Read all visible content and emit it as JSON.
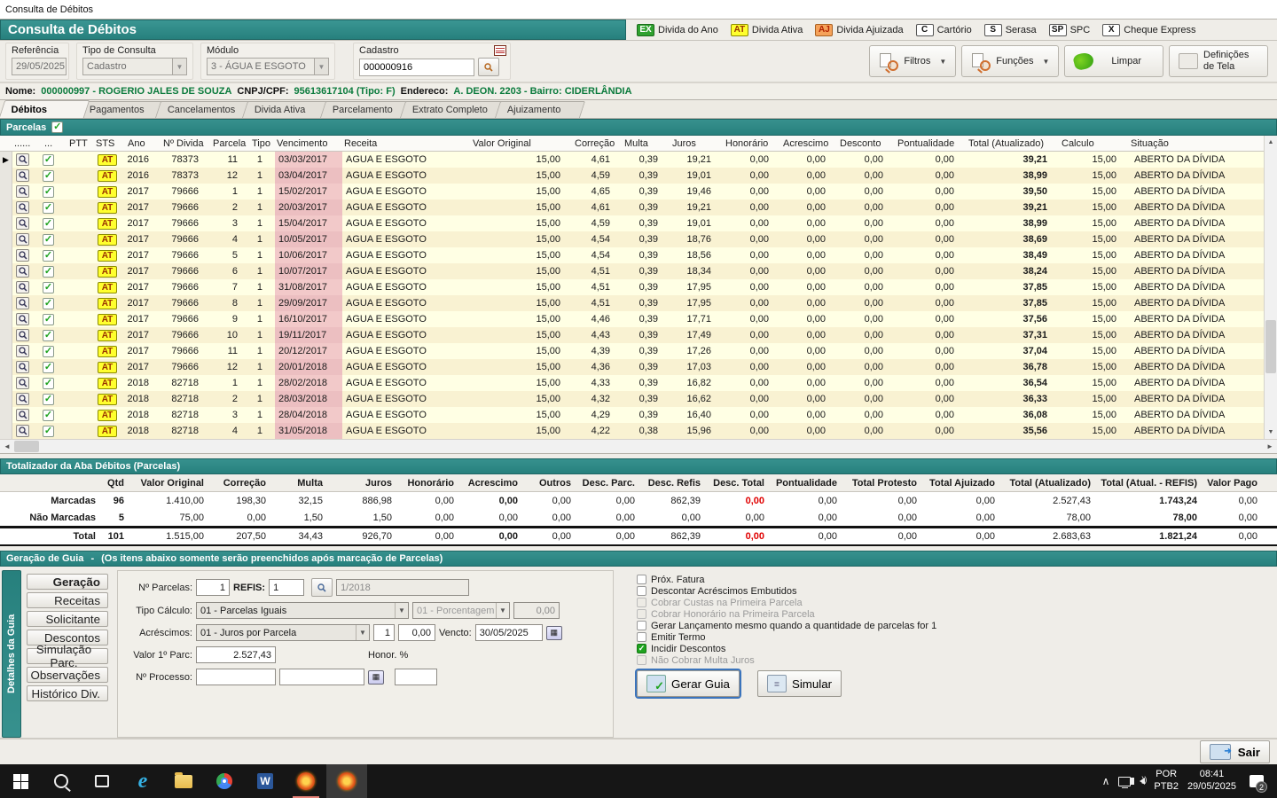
{
  "window": {
    "title": "Consulta de Débitos"
  },
  "app_header": {
    "title": "Consulta de Débitos",
    "legend": [
      {
        "badge": "EX",
        "label": "Divida do Ano",
        "bg": "#2FA12F",
        "fg": "#ffffff",
        "border": "#1a6b1a"
      },
      {
        "badge": "AT",
        "label": "Divida Ativa",
        "bg": "#FFFF2e",
        "fg": "#993300",
        "border": "#8B8B00"
      },
      {
        "badge": "AJ",
        "label": "Divida Ajuizada",
        "bg": "#F5A25A",
        "fg": "#B22200",
        "border": "#A96020"
      },
      {
        "badge": "C",
        "label": "Cartório",
        "bg": "#ffffff",
        "fg": "#111111",
        "border": "#555555"
      },
      {
        "badge": "S",
        "label": "Serasa",
        "bg": "#ffffff",
        "fg": "#111111",
        "border": "#555555"
      },
      {
        "badge": "SP",
        "label": "SPC",
        "bg": "#ffffff",
        "fg": "#111111",
        "border": "#555555"
      },
      {
        "badge": "X",
        "label": "Cheque Express",
        "bg": "#ffffff",
        "fg": "#111111",
        "border": "#555555"
      }
    ]
  },
  "filters": {
    "referencia_label": "Referência",
    "referencia": "29/05/2025",
    "tipo_label": "Tipo de Consulta",
    "tipo": "Cadastro",
    "modulo_label": "Módulo",
    "modulo": "3 - ÁGUA E ESGOTO",
    "cadastro_label": "Cadastro",
    "cadastro": "000000916"
  },
  "toolbar": {
    "filtros": "Filtros",
    "funcoes": "Funções",
    "limpar": "Limpar",
    "definicoes": "Definições de Tela"
  },
  "client": {
    "nome_label": "Nome:",
    "nome": "000000997 - ROGERIO JALES DE SOUZA",
    "doc_label": "CNPJ/CPF:",
    "doc": "95613617104 (Tipo: F)",
    "end_label": "Endereco:",
    "endereco": "A. DEON. 2203 - Bairro: CIDERLÂNDIA"
  },
  "tabs": [
    "Débitos",
    "Pagamentos",
    "Cancelamentos",
    "Divida Ativa",
    "Parcelamento",
    "Extrato Completo",
    "Ajuizamento"
  ],
  "active_tab": "Débitos",
  "parcelas_label": "Parcelas",
  "table": {
    "headers": [
      "",
      "......",
      "...",
      "PTT",
      "STS",
      "Ano",
      "Nº Divida",
      "Parcela",
      "Tipo",
      "Vencimento",
      "Receita",
      "Valor Original",
      "Correção",
      "Multa",
      "Juros",
      "Honorário",
      "Acrescimo",
      "Desconto",
      "Pontualidade",
      "Total (Atualizado)",
      "Calculo",
      "Situação"
    ],
    "rows": [
      {
        "sts": "AT",
        "ano": "2016",
        "divida": "78373",
        "parcela": "11",
        "tipo": "1",
        "venc": "03/03/2017",
        "receita": "AGUA E ESGOTO",
        "valor": "15,00",
        "correcao": "4,61",
        "multa": "0,39",
        "juros": "19,21",
        "honorario": "0,00",
        "acrescimo": "0,00",
        "desconto": "0,00",
        "pontualidade": "0,00",
        "total": "39,21",
        "calculo": "15,00",
        "situacao": "ABERTO DA DÍVIDA"
      },
      {
        "sts": "AT",
        "ano": "2016",
        "divida": "78373",
        "parcela": "12",
        "tipo": "1",
        "venc": "03/04/2017",
        "receita": "AGUA E ESGOTO",
        "valor": "15,00",
        "correcao": "4,59",
        "multa": "0,39",
        "juros": "19,01",
        "honorario": "0,00",
        "acrescimo": "0,00",
        "desconto": "0,00",
        "pontualidade": "0,00",
        "total": "38,99",
        "calculo": "15,00",
        "situacao": "ABERTO DA DÍVIDA"
      },
      {
        "sts": "AT",
        "ano": "2017",
        "divida": "79666",
        "parcela": "1",
        "tipo": "1",
        "venc": "15/02/2017",
        "receita": "AGUA E ESGOTO",
        "valor": "15,00",
        "correcao": "4,65",
        "multa": "0,39",
        "juros": "19,46",
        "honorario": "0,00",
        "acrescimo": "0,00",
        "desconto": "0,00",
        "pontualidade": "0,00",
        "total": "39,50",
        "calculo": "15,00",
        "situacao": "ABERTO DA DÍVIDA"
      },
      {
        "sts": "AT",
        "ano": "2017",
        "divida": "79666",
        "parcela": "2",
        "tipo": "1",
        "venc": "20/03/2017",
        "receita": "AGUA E ESGOTO",
        "valor": "15,00",
        "correcao": "4,61",
        "multa": "0,39",
        "juros": "19,21",
        "honorario": "0,00",
        "acrescimo": "0,00",
        "desconto": "0,00",
        "pontualidade": "0,00",
        "total": "39,21",
        "calculo": "15,00",
        "situacao": "ABERTO DA DÍVIDA"
      },
      {
        "sts": "AT",
        "ano": "2017",
        "divida": "79666",
        "parcela": "3",
        "tipo": "1",
        "venc": "15/04/2017",
        "receita": "AGUA E ESGOTO",
        "valor": "15,00",
        "correcao": "4,59",
        "multa": "0,39",
        "juros": "19,01",
        "honorario": "0,00",
        "acrescimo": "0,00",
        "desconto": "0,00",
        "pontualidade": "0,00",
        "total": "38,99",
        "calculo": "15,00",
        "situacao": "ABERTO DA DÍVIDA"
      },
      {
        "sts": "AT",
        "ano": "2017",
        "divida": "79666",
        "parcela": "4",
        "tipo": "1",
        "venc": "10/05/2017",
        "receita": "AGUA E ESGOTO",
        "valor": "15,00",
        "correcao": "4,54",
        "multa": "0,39",
        "juros": "18,76",
        "honorario": "0,00",
        "acrescimo": "0,00",
        "desconto": "0,00",
        "pontualidade": "0,00",
        "total": "38,69",
        "calculo": "15,00",
        "situacao": "ABERTO DA DÍVIDA"
      },
      {
        "sts": "AT",
        "ano": "2017",
        "divida": "79666",
        "parcela": "5",
        "tipo": "1",
        "venc": "10/06/2017",
        "receita": "AGUA E ESGOTO",
        "valor": "15,00",
        "correcao": "4,54",
        "multa": "0,39",
        "juros": "18,56",
        "honorario": "0,00",
        "acrescimo": "0,00",
        "desconto": "0,00",
        "pontualidade": "0,00",
        "total": "38,49",
        "calculo": "15,00",
        "situacao": "ABERTO DA DÍVIDA"
      },
      {
        "sts": "AT",
        "ano": "2017",
        "divida": "79666",
        "parcela": "6",
        "tipo": "1",
        "venc": "10/07/2017",
        "receita": "AGUA E ESGOTO",
        "valor": "15,00",
        "correcao": "4,51",
        "multa": "0,39",
        "juros": "18,34",
        "honorario": "0,00",
        "acrescimo": "0,00",
        "desconto": "0,00",
        "pontualidade": "0,00",
        "total": "38,24",
        "calculo": "15,00",
        "situacao": "ABERTO DA DÍVIDA"
      },
      {
        "sts": "AT",
        "ano": "2017",
        "divida": "79666",
        "parcela": "7",
        "tipo": "1",
        "venc": "31/08/2017",
        "receita": "AGUA E ESGOTO",
        "valor": "15,00",
        "correcao": "4,51",
        "multa": "0,39",
        "juros": "17,95",
        "honorario": "0,00",
        "acrescimo": "0,00",
        "desconto": "0,00",
        "pontualidade": "0,00",
        "total": "37,85",
        "calculo": "15,00",
        "situacao": "ABERTO DA DÍVIDA"
      },
      {
        "sts": "AT",
        "ano": "2017",
        "divida": "79666",
        "parcela": "8",
        "tipo": "1",
        "venc": "29/09/2017",
        "receita": "AGUA E ESGOTO",
        "valor": "15,00",
        "correcao": "4,51",
        "multa": "0,39",
        "juros": "17,95",
        "honorario": "0,00",
        "acrescimo": "0,00",
        "desconto": "0,00",
        "pontualidade": "0,00",
        "total": "37,85",
        "calculo": "15,00",
        "situacao": "ABERTO DA DÍVIDA"
      },
      {
        "sts": "AT",
        "ano": "2017",
        "divida": "79666",
        "parcela": "9",
        "tipo": "1",
        "venc": "16/10/2017",
        "receita": "AGUA E ESGOTO",
        "valor": "15,00",
        "correcao": "4,46",
        "multa": "0,39",
        "juros": "17,71",
        "honorario": "0,00",
        "acrescimo": "0,00",
        "desconto": "0,00",
        "pontualidade": "0,00",
        "total": "37,56",
        "calculo": "15,00",
        "situacao": "ABERTO DA DÍVIDA"
      },
      {
        "sts": "AT",
        "ano": "2017",
        "divida": "79666",
        "parcela": "10",
        "tipo": "1",
        "venc": "19/11/2017",
        "receita": "AGUA E ESGOTO",
        "valor": "15,00",
        "correcao": "4,43",
        "multa": "0,39",
        "juros": "17,49",
        "honorario": "0,00",
        "acrescimo": "0,00",
        "desconto": "0,00",
        "pontualidade": "0,00",
        "total": "37,31",
        "calculo": "15,00",
        "situacao": "ABERTO DA DÍVIDA"
      },
      {
        "sts": "AT",
        "ano": "2017",
        "divida": "79666",
        "parcela": "11",
        "tipo": "1",
        "venc": "20/12/2017",
        "receita": "AGUA E ESGOTO",
        "valor": "15,00",
        "correcao": "4,39",
        "multa": "0,39",
        "juros": "17,26",
        "honorario": "0,00",
        "acrescimo": "0,00",
        "desconto": "0,00",
        "pontualidade": "0,00",
        "total": "37,04",
        "calculo": "15,00",
        "situacao": "ABERTO DA DÍVIDA"
      },
      {
        "sts": "AT",
        "ano": "2017",
        "divida": "79666",
        "parcela": "12",
        "tipo": "1",
        "venc": "20/01/2018",
        "receita": "AGUA E ESGOTO",
        "valor": "15,00",
        "correcao": "4,36",
        "multa": "0,39",
        "juros": "17,03",
        "honorario": "0,00",
        "acrescimo": "0,00",
        "desconto": "0,00",
        "pontualidade": "0,00",
        "total": "36,78",
        "calculo": "15,00",
        "situacao": "ABERTO DA DÍVIDA"
      },
      {
        "sts": "AT",
        "ano": "2018",
        "divida": "82718",
        "parcela": "1",
        "tipo": "1",
        "venc": "28/02/2018",
        "receita": "AGUA E ESGOTO",
        "valor": "15,00",
        "correcao": "4,33",
        "multa": "0,39",
        "juros": "16,82",
        "honorario": "0,00",
        "acrescimo": "0,00",
        "desconto": "0,00",
        "pontualidade": "0,00",
        "total": "36,54",
        "calculo": "15,00",
        "situacao": "ABERTO DA DÍVIDA"
      },
      {
        "sts": "AT",
        "ano": "2018",
        "divida": "82718",
        "parcela": "2",
        "tipo": "1",
        "venc": "28/03/2018",
        "receita": "AGUA E ESGOTO",
        "valor": "15,00",
        "correcao": "4,32",
        "multa": "0,39",
        "juros": "16,62",
        "honorario": "0,00",
        "acrescimo": "0,00",
        "desconto": "0,00",
        "pontualidade": "0,00",
        "total": "36,33",
        "calculo": "15,00",
        "situacao": "ABERTO DA DÍVIDA"
      },
      {
        "sts": "AT",
        "ano": "2018",
        "divida": "82718",
        "parcela": "3",
        "tipo": "1",
        "venc": "28/04/2018",
        "receita": "AGUA E ESGOTO",
        "valor": "15,00",
        "correcao": "4,29",
        "multa": "0,39",
        "juros": "16,40",
        "honorario": "0,00",
        "acrescimo": "0,00",
        "desconto": "0,00",
        "pontualidade": "0,00",
        "total": "36,08",
        "calculo": "15,00",
        "situacao": "ABERTO DA DÍVIDA"
      },
      {
        "sts": "AT",
        "ano": "2018",
        "divida": "82718",
        "parcela": "4",
        "tipo": "1",
        "venc": "31/05/2018",
        "receita": "AGUA E ESGOTO",
        "valor": "15,00",
        "correcao": "4,22",
        "multa": "0,38",
        "juros": "15,96",
        "honorario": "0,00",
        "acrescimo": "0,00",
        "desconto": "0,00",
        "pontualidade": "0,00",
        "total": "35,56",
        "calculo": "15,00",
        "situacao": "ABERTO DA DÍVIDA"
      }
    ]
  },
  "totalizer": {
    "title": "Totalizador da Aba Débitos (Parcelas)",
    "headers": [
      "",
      "Qtd",
      "Valor Original",
      "Correção",
      "Multa",
      "Juros",
      "Honorário",
      "Acrescimo",
      "Outros",
      "Desc. Parc.",
      "Desc. Refis",
      "Desc. Total",
      "Pontualidade",
      "Total Protesto",
      "Total Ajuizado",
      "Total (Atualizado)",
      "Total (Atual. - REFIS)",
      "Valor Pago"
    ],
    "rows": [
      {
        "label": "Marcadas",
        "values": [
          "96",
          "1.410,00",
          "198,30",
          "32,15",
          "886,98",
          "0,00",
          "0,00",
          "0,00",
          "0,00",
          "862,39",
          "0,00",
          "0,00",
          "0,00",
          "0,00",
          "2.527,43",
          "1.743,24",
          "0,00"
        ],
        "red_desc_total": true,
        "grand": false
      },
      {
        "label": "Não Marcadas",
        "values": [
          "5",
          "75,00",
          "0,00",
          "1,50",
          "1,50",
          "0,00",
          "0,00",
          "0,00",
          "0,00",
          "0,00",
          "0,00",
          "0,00",
          "0,00",
          "0,00",
          "78,00",
          "78,00",
          "0,00"
        ],
        "red_desc_total": false,
        "grand": false
      },
      {
        "label": "Total",
        "values": [
          "101",
          "1.515,00",
          "207,50",
          "34,43",
          "926,70",
          "0,00",
          "0,00",
          "0,00",
          "0,00",
          "862,39",
          "0,00",
          "0,00",
          "0,00",
          "0,00",
          "2.683,63",
          "1.821,24",
          "0,00"
        ],
        "red_desc_total": true,
        "grand": true
      }
    ]
  },
  "guia": {
    "title": "Geração de Guia",
    "sep": "-",
    "note": "(Os itens abaixo somente serão preenchidos após marcação de Parcelas)",
    "vertical_tab": "Detalhes da Guia",
    "side_buttons": [
      "Geração",
      "Receitas",
      "Solicitante",
      "Descontos",
      "Simulação Parc.",
      "Observações",
      "Histórico Div."
    ],
    "active_side_button": "Geração",
    "labels": {
      "n_parcelas": "Nº Parcelas:",
      "refis": "REFIS:",
      "tipo_calculo": "Tipo Cálculo:",
      "acrescimos": "Acréscimos:",
      "valor_1parc": "Valor 1º Parc:",
      "n_processo": "Nº Processo:",
      "vencto": "Vencto:",
      "honor": "Honor. %"
    },
    "values": {
      "n_parcelas": "1",
      "refis": "1",
      "refis_ref": "1/2018",
      "tipo_calculo": "01 - Parcelas Iguais",
      "porcentagem": "01 - Porcentagem",
      "porcentagem_val": "0,00",
      "acrescimos": "01 - Juros por Parcela",
      "acres_n": "1",
      "acres_val": "0,00",
      "vencto": "30/05/2025",
      "valor_1parc": "2.527,43",
      "n_processo": "",
      "processo_aux": "",
      "honor_val": ""
    },
    "checkboxes": [
      {
        "label": "Próx. Fatura",
        "state": "unchecked"
      },
      {
        "label": "Descontar Acréscimos Embutidos",
        "state": "unchecked"
      },
      {
        "label": "Cobrar Custas na Primeira Parcela",
        "state": "disabled"
      },
      {
        "label": "Cobrar Honorário na Primeira Parcela",
        "state": "disabled"
      },
      {
        "label": "Gerar Lançamento mesmo quando a quantidade de parcelas for 1",
        "state": "unchecked"
      },
      {
        "label": "Emitir Termo",
        "state": "unchecked"
      },
      {
        "label": "Incidir Descontos",
        "state": "checked"
      },
      {
        "label": "Não Cobrar Multa Juros",
        "state": "disabled"
      }
    ],
    "gerar_guia": "Gerar Guia",
    "simular": "Simular"
  },
  "footer": {
    "sair": "Sair"
  },
  "taskbar": {
    "lang1": "POR",
    "lang2": "PTB2",
    "time": "08:41",
    "date": "29/05/2025",
    "notif_count": "2",
    "apps": [
      "start",
      "search",
      "task-view",
      "internet-explorer",
      "file-explorer",
      "chrome",
      "word",
      "app-orange-1",
      "app-orange-2"
    ]
  }
}
